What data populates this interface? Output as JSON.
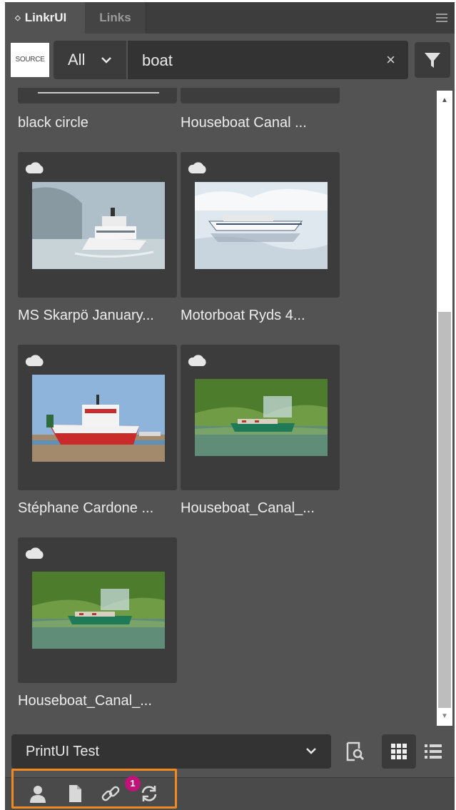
{
  "tabs": {
    "active": "LinkrUI",
    "second": "Links",
    "active_marker": "◇"
  },
  "search": {
    "source_logo": "SOURCE",
    "scope": "All",
    "query": "boat",
    "clear_symbol": "×"
  },
  "partial_row": {
    "left_caption": "black circle",
    "right_caption": "Houseboat Canal ..."
  },
  "items": [
    {
      "caption": "MS Skarpö January...",
      "cloud": true
    },
    {
      "caption": "Motorboat Ryds 4...",
      "cloud": true
    },
    {
      "caption": "Stéphane Cardone ...",
      "cloud": true
    },
    {
      "caption": "Houseboat_Canal_...",
      "cloud": true
    },
    {
      "caption": "Houseboat_Canal_...",
      "cloud": true
    }
  ],
  "bottom": {
    "document": "PrintUI Test",
    "view_mode": "grid"
  },
  "footer": {
    "links_badge": "1"
  },
  "colors": {
    "panel": "#535353",
    "highlight_border": "#f0891f",
    "badge": "#c0137a"
  }
}
